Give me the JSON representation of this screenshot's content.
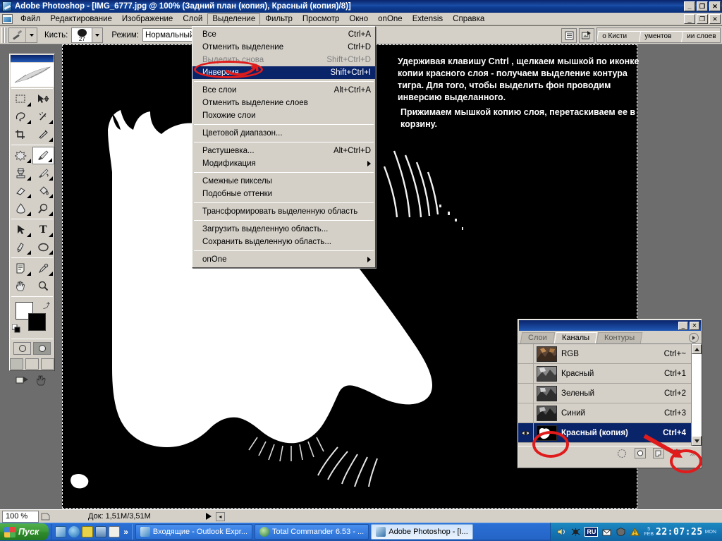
{
  "window": {
    "title": "Adobe Photoshop - [IMG_6777.jpg @ 100% (Задний план (копия), Красный (копия)/8)]",
    "app_minimize": "_",
    "app_restore": "❐",
    "app_close": "✕",
    "doc_minimize": "_",
    "doc_restore": "❐",
    "doc_close": "✕"
  },
  "menubar": {
    "items": [
      {
        "label": "Файл",
        "active": false
      },
      {
        "label": "Редактирование",
        "active": false
      },
      {
        "label": "Изображение",
        "active": false
      },
      {
        "label": "Слой",
        "active": false
      },
      {
        "label": "Выделение",
        "active": true
      },
      {
        "label": "Фильтр",
        "active": false
      },
      {
        "label": "Просмотр",
        "active": false
      },
      {
        "label": "Окно",
        "active": false
      },
      {
        "label": "onOne",
        "active": false
      },
      {
        "label": "Extensis",
        "active": false
      },
      {
        "label": "Справка",
        "active": false
      }
    ]
  },
  "options_bar": {
    "brush_label": "Кисть:",
    "brush_size": "27",
    "mode_label": "Режим:",
    "mode_value": "Нормальный",
    "palette_well_tabs": [
      "о Кисти",
      "ументов",
      "ии слоев"
    ]
  },
  "dropdown": {
    "items": [
      {
        "label": "Все",
        "shortcut": "Ctrl+A",
        "state": "normal"
      },
      {
        "label": "Отменить выделение",
        "shortcut": "Ctrl+D",
        "state": "normal"
      },
      {
        "label": "Выделить снова",
        "shortcut": "Shift+Ctrl+D",
        "state": "disabled"
      },
      {
        "label": "Инверсия",
        "shortcut": "Shift+Ctrl+I",
        "state": "highlighted"
      },
      {
        "separator": true
      },
      {
        "label": "Все слои",
        "shortcut": "Alt+Ctrl+A",
        "state": "normal"
      },
      {
        "label": "Отменить выделение слоев",
        "shortcut": "",
        "state": "normal"
      },
      {
        "label": "Похожие слои",
        "shortcut": "",
        "state": "normal"
      },
      {
        "separator": true
      },
      {
        "label": "Цветовой диапазон...",
        "shortcut": "",
        "state": "normal"
      },
      {
        "separator": true
      },
      {
        "label": "Растушевка...",
        "shortcut": "Alt+Ctrl+D",
        "state": "normal"
      },
      {
        "label": "Модификация",
        "shortcut": "",
        "state": "submenu"
      },
      {
        "separator": true
      },
      {
        "label": "Смежные пикселы",
        "shortcut": "",
        "state": "normal"
      },
      {
        "label": "Подобные оттенки",
        "shortcut": "",
        "state": "normal"
      },
      {
        "separator": true
      },
      {
        "label": "Трансформировать выделенную область",
        "shortcut": "",
        "state": "normal"
      },
      {
        "separator": true
      },
      {
        "label": "Загрузить выделенную область...",
        "shortcut": "",
        "state": "normal"
      },
      {
        "label": "Сохранить выделенную область...",
        "shortcut": "",
        "state": "normal"
      },
      {
        "separator": true
      },
      {
        "label": "onOne",
        "shortcut": "",
        "state": "submenu"
      }
    ]
  },
  "instructions": {
    "paragraph1": "Удерживая клавишу Cntrl , щелкаем мышкой по иконке копии красного слоя - получаем выделение контура тигра. Для того, чтобы выделить фон проводим инверсию выделанного.",
    "paragraph2": "Прижимаем мышкой копию слоя, перетаскиваем ее в корзину."
  },
  "channels_panel": {
    "tabs": [
      {
        "label": "Слои",
        "active": false
      },
      {
        "label": "Каналы",
        "active": true
      },
      {
        "label": "Контуры",
        "active": false
      }
    ],
    "rows": [
      {
        "name": "RGB",
        "shortcut": "Ctrl+~",
        "visible": false,
        "selected": false
      },
      {
        "name": "Красный",
        "shortcut": "Ctrl+1",
        "visible": false,
        "selected": false
      },
      {
        "name": "Зеленый",
        "shortcut": "Ctrl+2",
        "visible": false,
        "selected": false
      },
      {
        "name": "Синий",
        "shortcut": "Ctrl+3",
        "visible": false,
        "selected": false
      },
      {
        "name": "Красный (копия)",
        "shortcut": "Ctrl+4",
        "visible": true,
        "selected": true
      }
    ],
    "footer_icons": [
      "load-selection-icon",
      "save-selection-icon",
      "new-channel-icon",
      "delete-channel-icon"
    ],
    "minimize": "_",
    "close": "✕"
  },
  "status_bar": {
    "zoom": "100 %",
    "doc_info": "Док: 1,51М/3,51М"
  },
  "taskbar": {
    "start_label": "Пуск",
    "quick_launch": [
      "show-desktop-icon",
      "internet-explorer-icon",
      "save-icon",
      "media-icon",
      "edit-icon"
    ],
    "more_chevron": "»",
    "tasks": [
      {
        "label": "Входящие - Outlook Expr...",
        "active": false
      },
      {
        "label": "Total Commander 6.53 - ...",
        "active": false
      },
      {
        "label": "Adobe Photoshop - [I...",
        "active": true
      }
    ],
    "tray": {
      "language": "RU",
      "icons": [
        "volume-icon",
        "antivirus-icon",
        "mail-icon",
        "shield-icon",
        "warning-icon"
      ],
      "date_day": "5",
      "date_month": "FEB",
      "time": "22:07:25",
      "day_of_week": "MON"
    }
  },
  "toolbox": {
    "tools": [
      "marquee-tool",
      "move-tool",
      "lasso-tool",
      "magic-wand-tool",
      "crop-tool",
      "slice-tool",
      "healing-brush-tool",
      "brush-tool",
      "clone-stamp-tool",
      "history-brush-tool",
      "eraser-tool",
      "paint-bucket-tool",
      "blur-tool",
      "dodge-tool",
      "path-selection-tool",
      "type-tool",
      "pen-tool",
      "shape-tool",
      "notes-tool",
      "eyedropper-tool",
      "hand-tool",
      "zoom-tool"
    ],
    "selected_tool": "brush-tool",
    "foreground_color": "#ffffff",
    "background_color": "#000000"
  },
  "colors": {
    "titlebar_blue": "#0a246a",
    "chrome_gray": "#d4d0c8",
    "highlight_blue": "#0a246a",
    "annotation_red": "#e01b1b",
    "canvas_black": "#000000",
    "mask_white": "#ffffff"
  }
}
